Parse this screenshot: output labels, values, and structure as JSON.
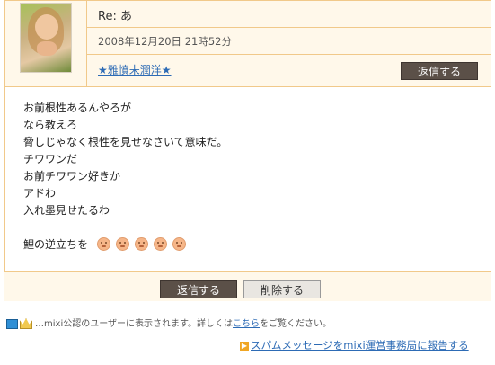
{
  "message": {
    "subject": "Re: あ",
    "date": "2008年12月20日 21時52分",
    "sender": "★雅憤未潤洋★",
    "reply_label": "返信する",
    "body_lines": [
      "お前根性あるんやろが",
      "なら教えろ",
      "脅しじゃなく根性を見せなさいて意味だ。",
      "チワワンだ",
      "お前チワワン好きか",
      "アドわ",
      "入れ墨見せたるわ",
      "",
      "鯉の逆立ちを"
    ],
    "emoji_icons": [
      "face-emoji",
      "face-emoji",
      "face-emoji",
      "face-emoji",
      "face-emoji"
    ]
  },
  "actions": {
    "reply_label": "返信する",
    "delete_label": "削除する"
  },
  "footer": {
    "note_prefix": "…mixi公認のユーザーに表示されます。詳しくは",
    "note_link": "こちら",
    "note_suffix": "をご覧ください。",
    "report_link": "スパムメッセージをmixi運営事務局に報告する"
  },
  "colors": {
    "border": "#f1c98a",
    "header_bg": "#fff8ea",
    "button_dark": "#5b5048",
    "link": "#2d6bb5"
  }
}
